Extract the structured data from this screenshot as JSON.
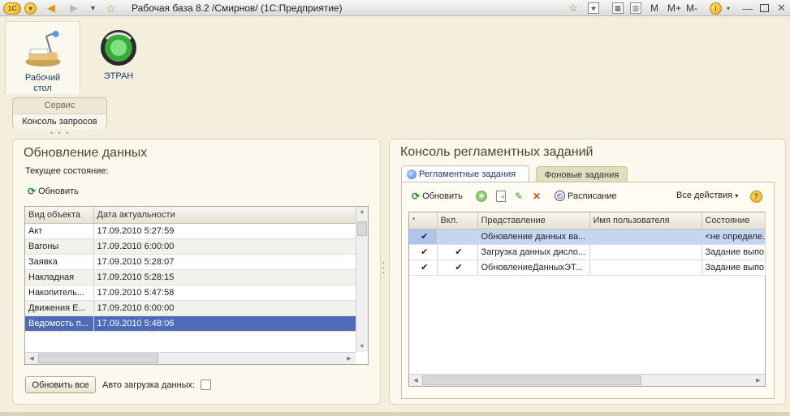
{
  "window": {
    "title": "Рабочая база 8.2 /Смирнов/  (1С:Предприятие)",
    "mem_buttons": [
      "M",
      "M+",
      "M-"
    ]
  },
  "sections": [
    {
      "label": "Рабочий стол",
      "icon": "desk-icon"
    },
    {
      "label": "ЭТРАН",
      "icon": "etran-icon"
    }
  ],
  "service": {
    "header": "Сервис",
    "item": "Консоль запросов"
  },
  "data_update": {
    "title": "Обновление данных",
    "current_state_label": "Текущее состояние:",
    "refresh_label": "Обновить",
    "columns": [
      "Вид объекта",
      "Дата актуальности"
    ],
    "rows": [
      [
        "Акт",
        "17.09.2010 5:27:59"
      ],
      [
        "Вагоны",
        "17.09.2010 6:00:00"
      ],
      [
        "Заявка",
        "17.09.2010 5:28:07"
      ],
      [
        "Накладная",
        "17.09.2010 5:28:15"
      ],
      [
        "Накопитель...",
        "17.09.2010 5:47:58"
      ],
      [
        "Движения Е...",
        "17.09.2010 6:00:00"
      ],
      [
        "Ведомость п...",
        "17.09.2010 5:48:06"
      ]
    ],
    "refresh_all_label": "Обновить все",
    "autoload_label": "Авто загрузка данных:"
  },
  "jobs_console": {
    "title": "Консоль регламентных заданий",
    "tabs": [
      "Регламентные задания",
      "Фоновые задания"
    ],
    "toolbar": {
      "refresh_label": "Обновить",
      "schedule_label": "Расписание",
      "all_actions_label": "Все действия"
    },
    "columns": [
      "",
      "Вкл.",
      "Представление",
      "Имя пользователя",
      "Состояние"
    ],
    "rows": [
      {
        "mark": "✔",
        "enabled": "",
        "name": "Обновление данных ва...",
        "user": "",
        "state": "<не определе..."
      },
      {
        "mark": "✔",
        "enabled": "✔",
        "name": "Загрузка данных дисло...",
        "user": "",
        "state": "Задание выпо..."
      },
      {
        "mark": "✔",
        "enabled": "✔",
        "name": "ОбновлениеДанныхЭТ...",
        "user": "",
        "state": "Задание выпо..."
      }
    ]
  }
}
